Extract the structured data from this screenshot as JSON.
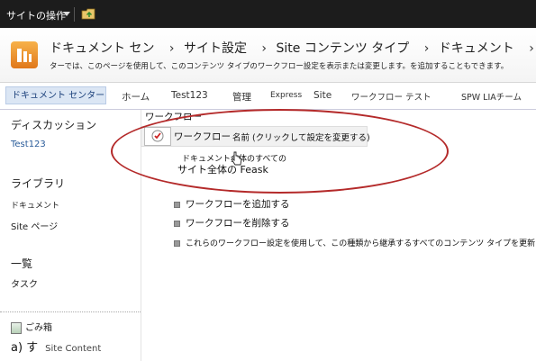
{
  "topbar": {
    "site_actions": "サイトの操作"
  },
  "breadcrumb": {
    "items": [
      "ドキュメント セン",
      "サイト設定",
      "Site コンテンツ タイプ",
      "ドキュメント"
    ],
    "description": "ターでは、このページを使用して、このコンテンツ タイプのワークフロー設定を表示または変更します。を追加することもできます。"
  },
  "nav": {
    "items": [
      "ドキュメント センター",
      "ホーム",
      "Test123",
      "管理",
      "Express",
      "Site",
      "ワークフロー テスト",
      "SPW LIAチーム"
    ]
  },
  "leftnav": {
    "discussions_heading": "ディスカッション",
    "discussions_item": "Test123",
    "libraries_heading": "ライブラリ",
    "libraries_item1": "ドキュメント",
    "libraries_item2": "Site ページ",
    "lists_heading": "一覧",
    "lists_item": "タスク",
    "recycle": "ごみ箱",
    "bottom_text": "a) す",
    "bottom_small": "Site Content"
  },
  "content": {
    "title": "ワークフロー",
    "col_workflow": "ワークフロー",
    "col_name": "名前 (クリックして設定を変更する)",
    "row_line1": "ドキュメント全体のすべての",
    "row_line2": "サイト全体の Feask",
    "actions": [
      "ワークフローを追加する",
      "ワークフローを削除する",
      "これらのワークフロー設定を使用して、この種類から継承するすべてのコンテンツ タイプを更新します"
    ]
  },
  "colors": {
    "accent_red": "#b42a2a",
    "nav_highlight": "#dbe6f4",
    "topbar": "#1c1c1c"
  }
}
